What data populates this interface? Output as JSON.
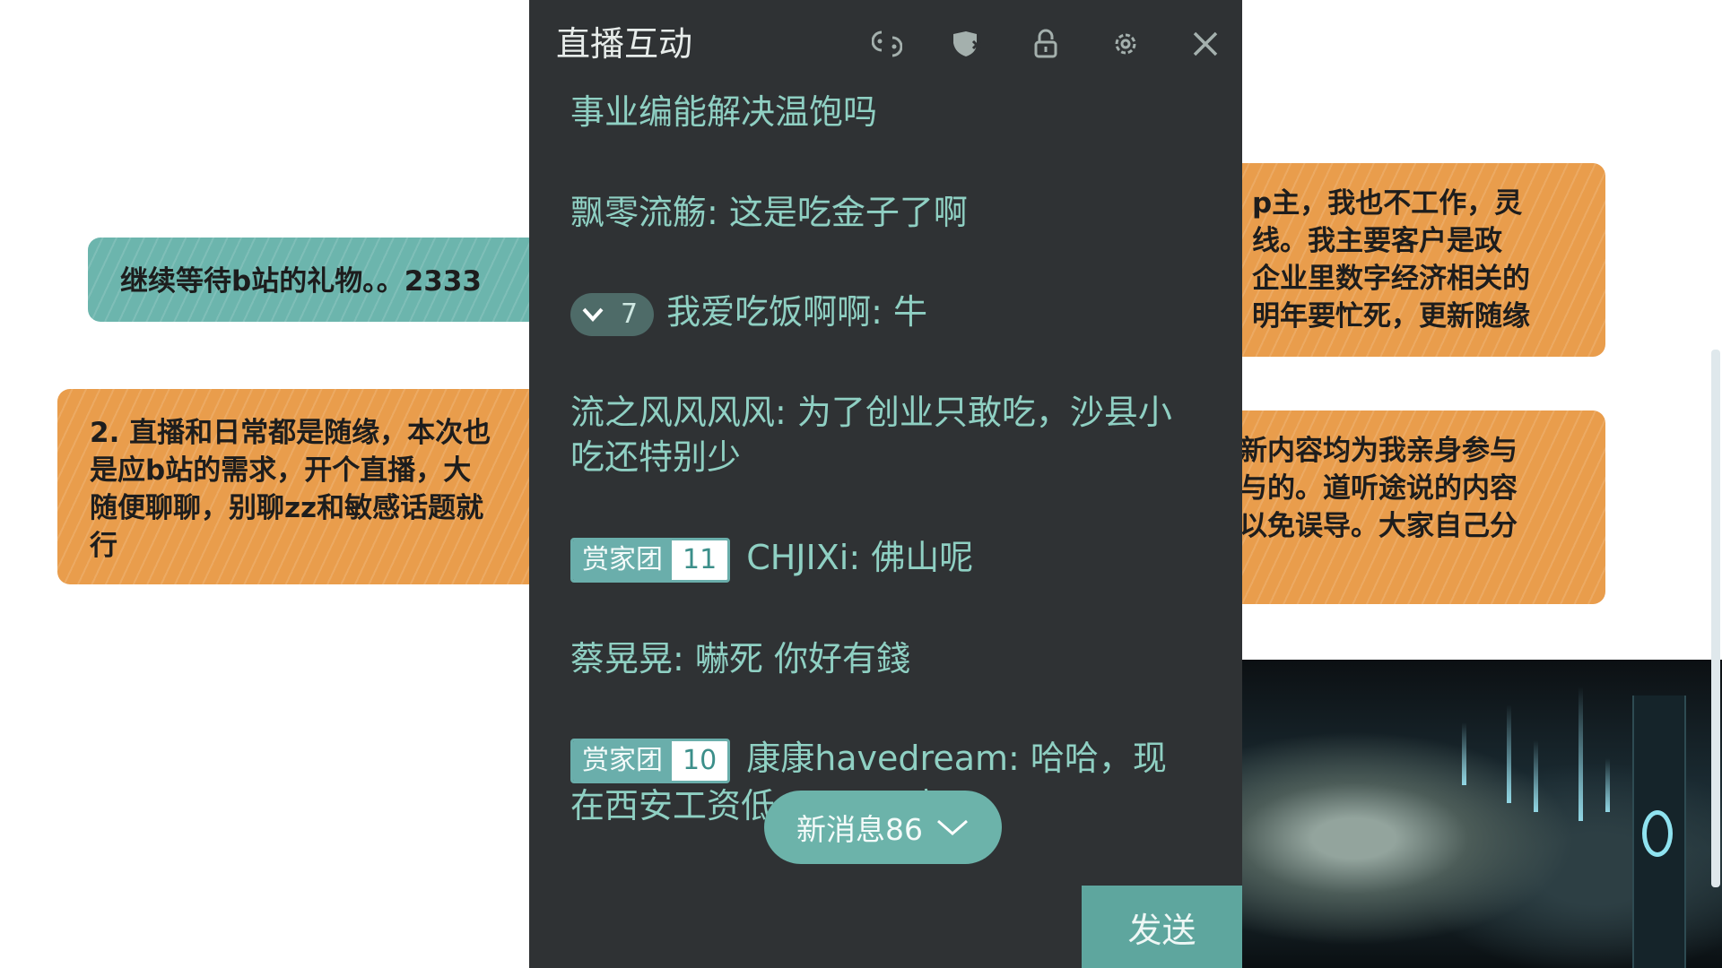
{
  "background": {
    "notes": [
      {
        "id": "a",
        "color": "teal",
        "lines": [
          "继续等待b站的礼物。。2333"
        ]
      },
      {
        "id": "b",
        "color": "orange",
        "lines": [
          "2. 直播和日常都是随缘，本次也",
          "是应b站的需求，开个直播，大",
          "随便聊聊，别聊zz和敏感话题就",
          "行"
        ]
      },
      {
        "id": "c",
        "color": "orange",
        "lines": [
          "p主，我也不工作，灵",
          "线。我主要客户是政",
          "企业里数字经济相关的",
          "明年要忙死，更新随缘"
        ]
      },
      {
        "id": "d",
        "color": "orange",
        "lines": [
          "新内容均为我亲身参与",
          "与的。道听途说的内容",
          "以免误导。大家自己分"
        ]
      }
    ],
    "colors": {
      "teal": "#6cb5ad",
      "orange": "#e99d4c"
    }
  },
  "panel": {
    "title": "直播互动",
    "toolbar": [
      {
        "name": "effects-icon"
      },
      {
        "name": "shield-icon"
      },
      {
        "name": "lock-icon"
      },
      {
        "name": "settings-gear-icon"
      },
      {
        "name": "close-icon"
      }
    ],
    "messages": [
      {
        "text": "事业编能解决温饱吗"
      },
      {
        "user": "飘零流觞",
        "text": "这是吃金子了啊"
      },
      {
        "badge_level": "7",
        "user": "我爱吃饭啊啊",
        "text": "牛"
      },
      {
        "user": "流之风风风风",
        "text": "为了创业只敢吃，沙县小吃还特别少"
      },
      {
        "fan_badge": "赏家团",
        "fan_level": "11",
        "user": "CHJIXi",
        "text": "佛山呢"
      },
      {
        "user": "蔡晃晃",
        "text": "嚇死 你好有錢"
      },
      {
        "fan_badge": "赏家团",
        "fan_level": "10",
        "user": "康康havedream",
        "text": "哈哈，现在西安工资低",
        "text_tail": "高"
      }
    ],
    "new_messages": "新消息86",
    "send_label": "发送"
  }
}
